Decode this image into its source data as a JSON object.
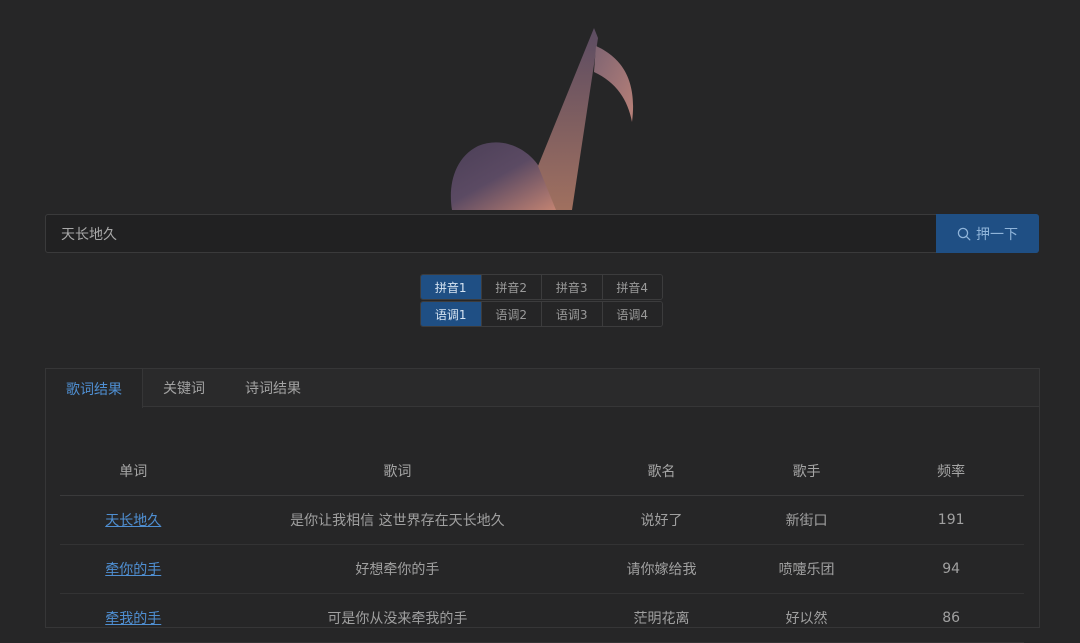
{
  "search": {
    "value": "天长地久",
    "button_label": "押一下"
  },
  "pinyin_options": [
    {
      "label": "拼音1",
      "active": true
    },
    {
      "label": "拼音2",
      "active": false
    },
    {
      "label": "拼音3",
      "active": false
    },
    {
      "label": "拼音4",
      "active": false
    }
  ],
  "tone_options": [
    {
      "label": "语调1",
      "active": true
    },
    {
      "label": "语调2",
      "active": false
    },
    {
      "label": "语调3",
      "active": false
    },
    {
      "label": "语调4",
      "active": false
    }
  ],
  "tabs": [
    {
      "label": "歌词结果",
      "active": true
    },
    {
      "label": "关键词",
      "active": false
    },
    {
      "label": "诗词结果",
      "active": false
    }
  ],
  "table": {
    "headers": [
      "单词",
      "歌词",
      "歌名",
      "歌手",
      "频率"
    ],
    "rows": [
      {
        "word": "天长地久",
        "lyric": "是你让我相信 这世界存在天长地久",
        "song": "说好了",
        "artist": "新街口",
        "freq": "191"
      },
      {
        "word": "牵你的手",
        "lyric": "好想牵你的手",
        "song": "请你嫁给我",
        "artist": "喷嚏乐团",
        "freq": "94"
      },
      {
        "word": "牵我的手",
        "lyric": "可是你从没来牵我的手",
        "song": "茫明花离",
        "artist": "好以然",
        "freq": "86"
      }
    ]
  },
  "colors": {
    "accent": "#1f4f84",
    "link": "#4f8fd2",
    "background": "#262627"
  },
  "icons": {
    "logo": "music-note-logo",
    "search": "search-icon"
  }
}
